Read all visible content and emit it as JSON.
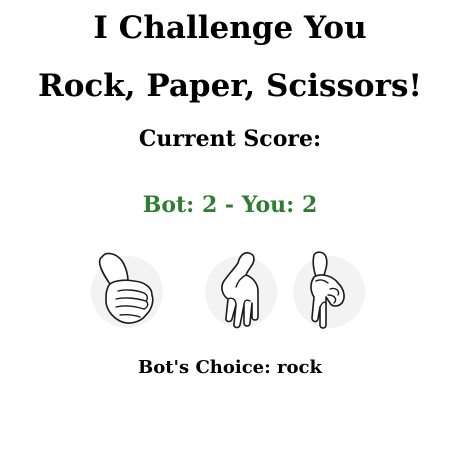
{
  "game": {
    "title_line1": "I Challenge You",
    "title_line2": "Rock, Paper, Scissors!",
    "score_label": "Current Score:",
    "score_text": "Bot: 2 - You: 2",
    "bot_choice_text": "Bot's Choice: rock"
  },
  "score": {
    "bot": 2,
    "you": 2
  },
  "choices": [
    {
      "id": "rock",
      "icon": "rock-fist-icon"
    },
    {
      "id": "paper",
      "icon": "paper-hand-icon"
    },
    {
      "id": "scissors",
      "icon": "scissors-hand-icon"
    }
  ],
  "bot_choice": "rock",
  "colors": {
    "score": "#2e7d32",
    "text": "#000000",
    "background": "#ffffff"
  }
}
